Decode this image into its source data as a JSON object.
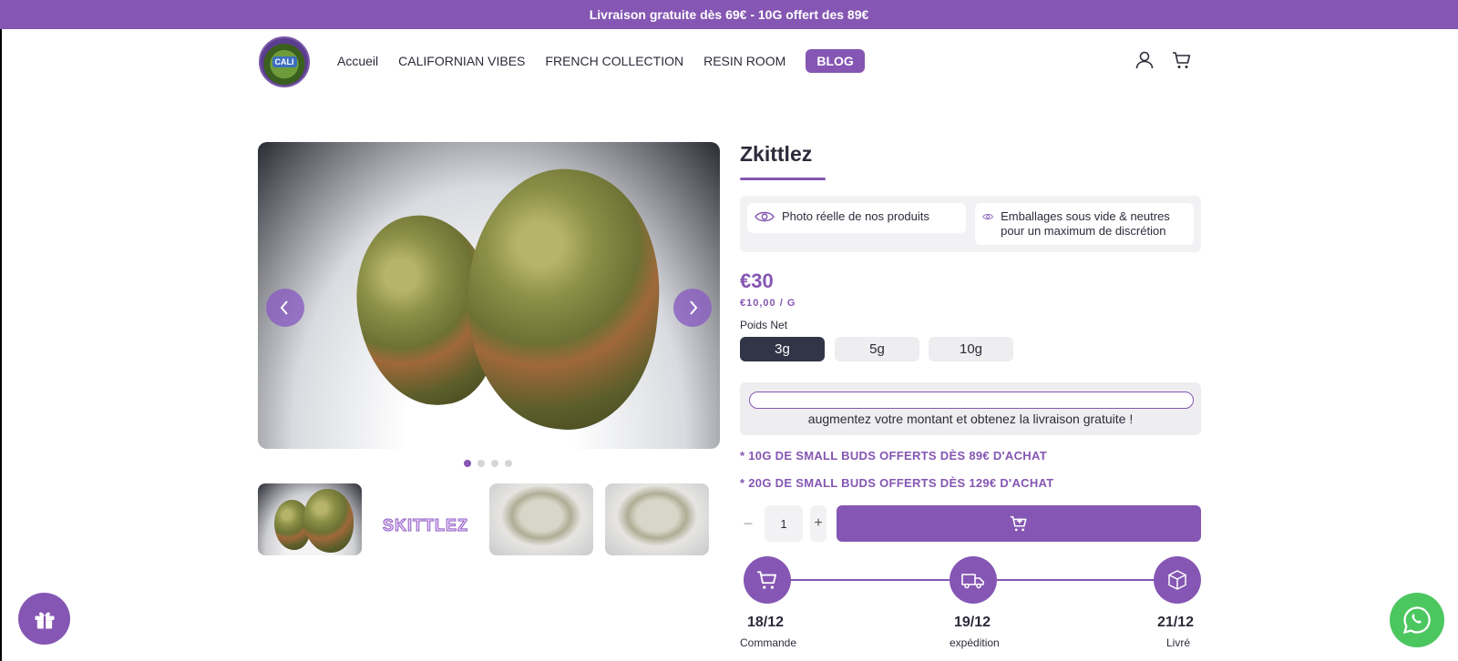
{
  "announcement": "Livraison gratuite dès 69€ - 10G offert des 89€",
  "header": {
    "logo_text": "CALI",
    "nav": [
      "Accueil",
      "CALIFORNIAN VIBES",
      "FRENCH COLLECTION",
      "RESIN ROOM",
      "BLOG"
    ],
    "account_icon": "user-icon",
    "cart_icon": "cart-icon"
  },
  "gallery": {
    "thumbnail_logo_text": "SKITTLEZ",
    "slide_count": 4,
    "active_slide": 1
  },
  "product": {
    "title": "Zkittlez",
    "trust": [
      {
        "icon": "eye-icon",
        "text": "Photo réelle de nos produits"
      },
      {
        "icon": "eye-icon",
        "text": "Emballages sous vide & neutres pour un maximum de discrétion"
      }
    ],
    "price": "€30",
    "unit_price": "€10,00 / G",
    "weight_label": "Poids Net",
    "weights": [
      "3g",
      "5g",
      "10g"
    ],
    "selected_weight": "3g",
    "shipping_progress": 0,
    "shipping_message": "augmentez votre montant et obtenez la livraison gratuite !",
    "promos": [
      "* 10G DE SMALL BUDS OFFERTS DÈS 89€ D'ACHAT",
      "* 20G DE SMALL BUDS OFFERTS DÈS 129€ D'ACHAT"
    ],
    "quantity": "1",
    "qty_minus": "−",
    "qty_plus": "+",
    "add_to_cart_icon": "cart-plus-icon"
  },
  "timeline": [
    {
      "date": "18/12",
      "label": "Commande",
      "icon": "cart-icon"
    },
    {
      "date": "19/12",
      "label": "expédition",
      "icon": "truck-icon"
    },
    {
      "date": "21/12",
      "label": "Livré",
      "icon": "box-icon"
    }
  ],
  "colors": {
    "accent": "#8556b3",
    "dark_button": "#313547",
    "whatsapp": "#4cc760"
  }
}
